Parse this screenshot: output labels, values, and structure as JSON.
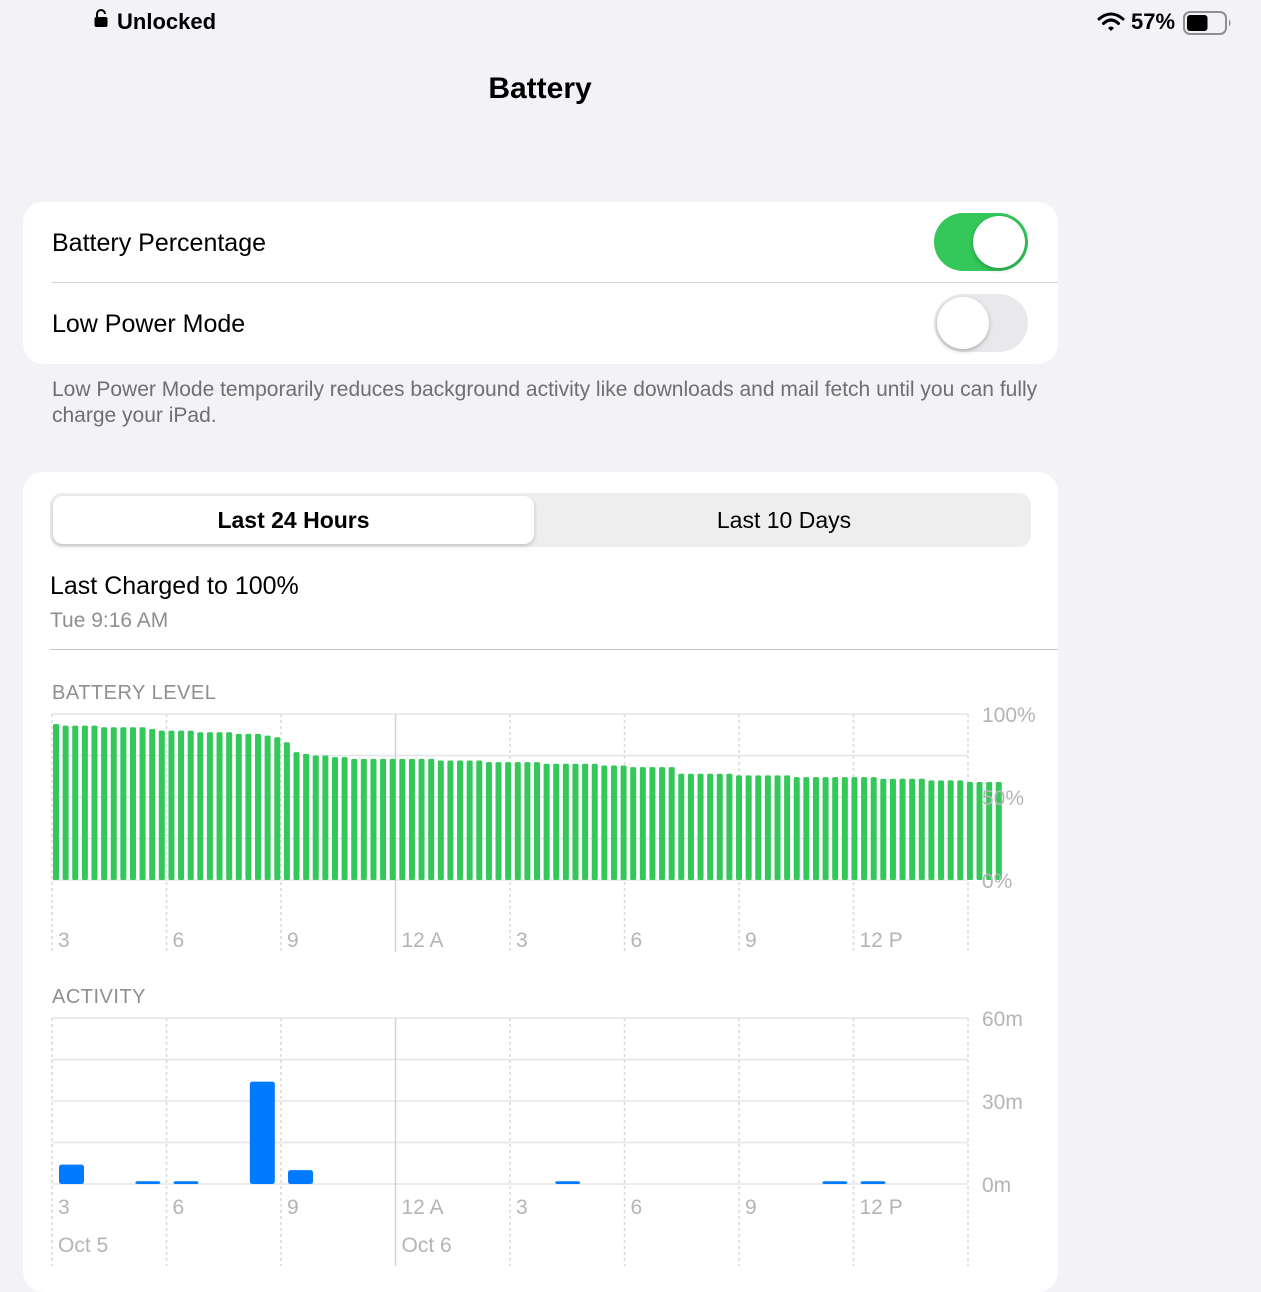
{
  "status_bar": {
    "lock_text": "Unlocked",
    "battery_percent": "57%"
  },
  "page": {
    "title": "Battery"
  },
  "settings": {
    "battery_percentage": {
      "label": "Battery Percentage",
      "on": true
    },
    "low_power_mode": {
      "label": "Low Power Mode",
      "on": false
    },
    "footnote": "Low Power Mode temporarily reduces background activity like downloads and mail fetch until you can fully charge your iPad."
  },
  "usage": {
    "segments": [
      "Last 24 Hours",
      "Last 10 Days"
    ],
    "selected_segment": "Last 24 Hours",
    "last_charged_title": "Last Charged to 100%",
    "last_charged_time": "Tue 9:16 AM"
  },
  "colors": {
    "accent_green": "#34c759",
    "activity_blue": "#007aff"
  },
  "chart_data": [
    {
      "type": "bar",
      "title": "BATTERY LEVEL",
      "x_tick_labels": [
        "3",
        "6",
        "9",
        "12 A",
        "3",
        "6",
        "9",
        "12 P"
      ],
      "y_tick_labels": [
        "100%",
        "50%",
        "0%"
      ],
      "ylim": [
        0,
        100
      ],
      "values": [
        94,
        93,
        93,
        93,
        93,
        92,
        92,
        92,
        92,
        92,
        91,
        90,
        90,
        90,
        90,
        89,
        89,
        89,
        89,
        88,
        88,
        88,
        87,
        86,
        83,
        77,
        76,
        75,
        75,
        74,
        74,
        73,
        73,
        73,
        73,
        73,
        73,
        73,
        73,
        73,
        72,
        72,
        72,
        72,
        72,
        71,
        71,
        71,
        71,
        71,
        71,
        70,
        70,
        70,
        70,
        70,
        70,
        69,
        69,
        69,
        68,
        68,
        68,
        68,
        68,
        64,
        64,
        64,
        64,
        64,
        64,
        63,
        63,
        63,
        63,
        63,
        63,
        62,
        62,
        62,
        62,
        62,
        62,
        62,
        62,
        62,
        61,
        61,
        61,
        61,
        61,
        60,
        60,
        60,
        60,
        59,
        59,
        59,
        59
      ]
    },
    {
      "type": "bar",
      "title": "ACTIVITY",
      "x_tick_labels": [
        "3",
        "6",
        "9",
        "12 A",
        "3",
        "6",
        "9",
        "12 P"
      ],
      "date_labels": [
        "Oct 5",
        "Oct 6"
      ],
      "y_tick_labels": [
        "60m",
        "30m",
        "0m"
      ],
      "ylim": [
        0,
        60
      ],
      "values": [
        7,
        0,
        1,
        1,
        0,
        37,
        5,
        0,
        0,
        0,
        0,
        0,
        0,
        1,
        0,
        0,
        0,
        0,
        0,
        0,
        1,
        1
      ]
    }
  ]
}
